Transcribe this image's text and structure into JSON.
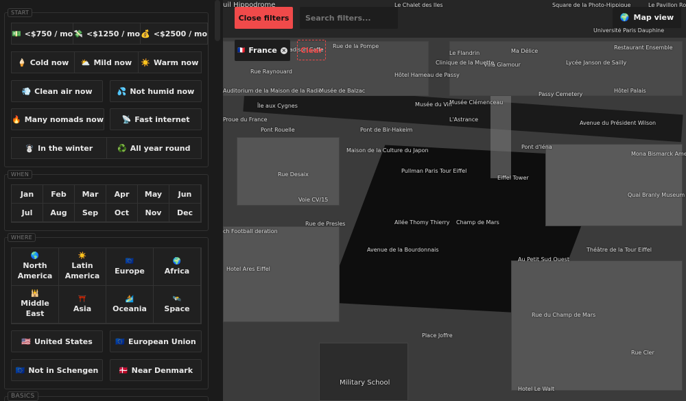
{
  "sidebar": {
    "start": {
      "label": "START",
      "budget": [
        {
          "icon": "💵",
          "label": "<$750 / mo"
        },
        {
          "icon": "💸",
          "label": "<$1250 / mo"
        },
        {
          "icon": "💰",
          "label": "<$2500 / mo"
        }
      ],
      "weather": [
        {
          "icon": "🍦",
          "label": "Cold now"
        },
        {
          "icon": "⛅",
          "label": "Mild now"
        },
        {
          "icon": "☀️",
          "label": "Warm now"
        }
      ],
      "air": [
        {
          "icon": "💨",
          "label": "Clean air now"
        },
        {
          "icon": "💦",
          "label": "Not humid now"
        }
      ],
      "nomads": [
        {
          "icon": "🔥",
          "label": "Many nomads now"
        },
        {
          "icon": "📡",
          "label": "Fast internet"
        }
      ],
      "season": [
        {
          "icon": "☃️",
          "label": "In the winter"
        },
        {
          "icon": "♻️",
          "label": "All year round"
        }
      ]
    },
    "when": {
      "label": "WHEN",
      "months": [
        "Jan",
        "Feb",
        "Mar",
        "Apr",
        "May",
        "Jun",
        "Jul",
        "Aug",
        "Sep",
        "Oct",
        "Nov",
        "Dec"
      ]
    },
    "where": {
      "label": "WHERE",
      "regions": [
        {
          "icon": "🌎",
          "label": "North America"
        },
        {
          "icon": "☀️",
          "label": "Latin America"
        },
        {
          "icon": "🇪🇺",
          "label": "Europe"
        },
        {
          "icon": "🌍",
          "label": "Africa"
        },
        {
          "icon": "🕌",
          "label": "Middle East"
        },
        {
          "icon": "⛩️",
          "label": "Asia"
        },
        {
          "icon": "🏄",
          "label": "Oceania"
        },
        {
          "icon": "🛰️",
          "label": "Space"
        }
      ],
      "countries": [
        {
          "icon": "🇺🇸",
          "label": "United States"
        },
        {
          "icon": "🇪🇺",
          "label": "European Union"
        }
      ],
      "other": [
        {
          "icon": "🇪🇺",
          "label": "Not in Schengen"
        },
        {
          "icon": "🇩🇰",
          "label": "Near Denmark"
        }
      ]
    },
    "basics": {
      "label": "BASICS"
    }
  },
  "map": {
    "close_filters": "Close filters",
    "search_placeholder": "Search filters...",
    "map_view": {
      "icon": "🌍",
      "label": "Map view"
    },
    "chip": {
      "icon": "🇫🇷",
      "label": "France"
    },
    "clear": "Clear",
    "labels": [
      "uil Hippodrome",
      "Le Chalet des Iles",
      "Square de la Photo-Hippique",
      "Le Pavillon Royal",
      "Université Paris Dauphine",
      "Restaurant Ensemble",
      "Madison Caffe",
      "Rue de la Pompe",
      "Le Flandrin",
      "Ma Délice",
      "Villa Glamour",
      "Lycée Janson de Sailly",
      "Clinique de la Muette",
      "Rue Raynouard",
      "Hôtel Hameau de Passy",
      "Musée de Balzac",
      "Auditorium de la Maison de la Radio",
      "Musée du Vin",
      "Musée Clémenceau",
      "Passy Cemetery",
      "Hôtel Palais",
      "Île aux Cygnes",
      "Proue du France",
      "Pont Rouelle",
      "Pont de Bir-Hakeim",
      "L'Astrance",
      "Avenue du Président Wilson",
      "Pont d'Iéna",
      "Maison de la Culture du Japon",
      "Pullman Paris Tour Eiffel",
      "Eiffel Tower",
      "Mona Bismarck American Center for art & culture",
      "Quai Branly Museum",
      "Rue Desaix",
      "Voie CV/15",
      "Rue de Presles",
      "Champ de Mars",
      "Allée Thomy Thierry",
      "ch Football deration",
      "Théâtre de la Tour Eiffel",
      "Au Petit Sud Ouest",
      "Hotel Ares Eiffel",
      "Place Joffre",
      "Military School",
      "Rue Cler",
      "Hotel Le Walt",
      "Avenue de la Bourdonnais",
      "Rue du Champ de Mars"
    ]
  }
}
